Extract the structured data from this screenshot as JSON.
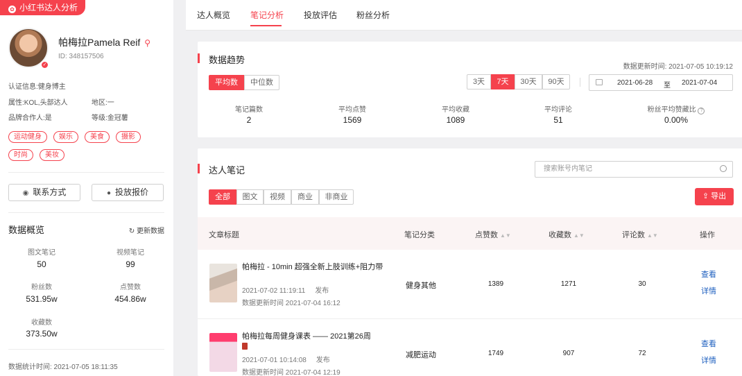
{
  "brand": {
    "label": "小红书达人分析"
  },
  "profile": {
    "name": "帕梅拉Pamela Reif",
    "id": "ID: 348157506",
    "certification": "认证信息:健身博主",
    "attribute": "属性:KOL,头部达人",
    "region": "地区:一",
    "brand_cooperation": "品牌合作人:是",
    "level": "等级:金冠薯",
    "tags": [
      "运动健身",
      "娱乐",
      "美食",
      "摄影",
      "时尚",
      "美妆"
    ]
  },
  "actions": {
    "contact": "联系方式",
    "quote": "投放报价"
  },
  "overview": {
    "title": "数据概览",
    "refresh": "更新数据",
    "stats": [
      {
        "label": "图文笔记",
        "value": "50"
      },
      {
        "label": "视频笔记",
        "value": "99"
      },
      {
        "label": "粉丝数",
        "value": "531.95w"
      },
      {
        "label": "点赞数",
        "value": "454.86w"
      },
      {
        "label": "收藏数",
        "value": "373.50w"
      }
    ],
    "stat_time": "数据统计时间: 2021-07-05 18:11:35"
  },
  "tabs": [
    "达人概览",
    "笔记分析",
    "投放评估",
    "粉丝分析"
  ],
  "active_tab": "笔记分析",
  "trend": {
    "title": "数据趋势",
    "update_time": "数据更新时间: 2021-07-05 10:19:12",
    "modes": [
      "平均数",
      "中位数"
    ],
    "ranges": [
      "3天",
      "7天",
      "30天",
      "90天"
    ],
    "date_start": "2021-06-28",
    "date_sep": "至",
    "date_end": "2021-07-04",
    "metrics": [
      {
        "label": "笔记篇数",
        "value": "2"
      },
      {
        "label": "平均点赞",
        "value": "1569"
      },
      {
        "label": "平均收藏",
        "value": "1089"
      },
      {
        "label": "平均评论",
        "value": "51"
      },
      {
        "label": "粉丝平均赞藏比",
        "value": "0.00%"
      }
    ]
  },
  "notes": {
    "title": "达人笔记",
    "search_placeholder": "搜索账号内笔记",
    "filters": [
      "全部",
      "图文",
      "视频",
      "商业",
      "非商业"
    ],
    "export": "导出",
    "columns": [
      "文章标题",
      "笔记分类",
      "点赞数",
      "收藏数",
      "评论数",
      "操作"
    ],
    "rows": [
      {
        "title": "帕梅拉 - 10min 超强全新上肢训练+阻力带",
        "published": "2021-07-02 11:19:11",
        "pub_label": "发布",
        "updated": "数据更新时间   2021-07-04 16:12",
        "category": "健身其他",
        "likes": "1389",
        "collects": "1271",
        "comments": "30",
        "op1": "查看",
        "op2": "详情"
      },
      {
        "title": "帕梅拉每周健身课表 —— 2021第26周",
        "published": "2021-07-01 10:14:08",
        "pub_label": "发布",
        "updated": "数据更新时间   2021-07-04 12:19",
        "category": "减肥运动",
        "likes": "1749",
        "collects": "907",
        "comments": "72",
        "op1": "查看",
        "op2": "详情"
      }
    ]
  },
  "colors": {
    "accent": "#f5424d",
    "link": "#1e5fbf"
  }
}
